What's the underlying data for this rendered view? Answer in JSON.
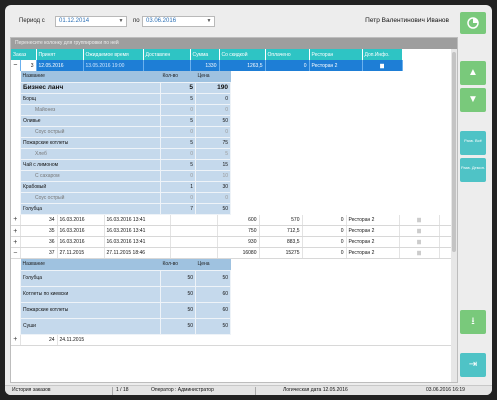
{
  "filter": {
    "period_label": "Период с",
    "from": "01.12.2014",
    "to_label": "по",
    "to": "03.06.2016"
  },
  "user": "Петр Валентинович Иванов",
  "group_hint": "Перенесите колонку для группировки по ней",
  "columns": [
    "Заказ",
    "Принят",
    "Ожидаемое время",
    "Доставлен",
    "Сумма",
    "Со скидкой",
    "Оплачено",
    "Ресторан",
    "Доп.Инфо."
  ],
  "selected": {
    "order": "3",
    "accepted": "12.05.2016",
    "expected": "13.05.2016 19:00",
    "delivered": "",
    "sum": "1330",
    "discount": "1263,5",
    "paid": "0",
    "rest": "Ресторан 2"
  },
  "detail_header": {
    "name": "Название",
    "qty": "Кол-во",
    "price": "Цена"
  },
  "detail1": [
    {
      "name": "Бизнес ланч",
      "qty": "5",
      "price": "190",
      "kind": "bold"
    },
    {
      "name": "Борщ",
      "qty": "5",
      "price": "0",
      "kind": "item"
    },
    {
      "name": "Майонез",
      "qty": "0",
      "price": "0",
      "kind": "sub"
    },
    {
      "name": "Оливье",
      "qty": "5",
      "price": "50",
      "kind": "item"
    },
    {
      "name": "Соус острый",
      "qty": "0",
      "price": "0",
      "kind": "sub"
    },
    {
      "name": "Пожарские котлеты",
      "qty": "5",
      "price": "75",
      "kind": "item"
    },
    {
      "name": "Хлеб",
      "qty": "0",
      "price": "5",
      "kind": "sub"
    },
    {
      "name": "Чай с лимоном",
      "qty": "5",
      "price": "15",
      "kind": "item"
    },
    {
      "name": "С сахаром",
      "qty": "0",
      "price": "10",
      "kind": "sub"
    },
    {
      "name": "Крабовый",
      "qty": "1",
      "price": "30",
      "kind": "item"
    },
    {
      "name": "Соус острый",
      "qty": "0",
      "price": "0",
      "kind": "sub"
    },
    {
      "name": "Голубца",
      "qty": "7",
      "price": "50",
      "kind": "item"
    }
  ],
  "orders": [
    {
      "exp": "+",
      "order": "34",
      "accepted": "16.03.2016",
      "expected": "16.03.2016 13:41",
      "sum": "600",
      "discount": "570",
      "paid": "0",
      "rest": "Ресторан 2"
    },
    {
      "exp": "+",
      "order": "35",
      "accepted": "16.03.2016",
      "expected": "16.03.2016 13:41",
      "sum": "750",
      "discount": "712,5",
      "paid": "0",
      "rest": "Ресторан 2"
    },
    {
      "exp": "+",
      "order": "36",
      "accepted": "16.03.2016",
      "expected": "16.03.2016 13:41",
      "sum": "930",
      "discount": "883,5",
      "paid": "0",
      "rest": "Ресторан 2"
    },
    {
      "exp": "−",
      "order": "37",
      "accepted": "27.11.2015",
      "expected": "27.11.2015 18:46",
      "sum": "16080",
      "discount": "15275",
      "paid": "0",
      "rest": "Ресторан 2"
    }
  ],
  "detail2": [
    {
      "name": "Голубца",
      "qty": "50",
      "price": "50"
    },
    {
      "name": "Котлеты по киевски",
      "qty": "50",
      "price": "60"
    },
    {
      "name": "Пожарские котлеты",
      "qty": "50",
      "price": "60"
    },
    {
      "name": "Суши",
      "qty": "50",
      "price": "50"
    }
  ],
  "last_row": {
    "exp": "+",
    "order": "24",
    "accepted": "24.11.2015"
  },
  "side": {
    "up": "▲",
    "down": "▼",
    "all_up": "Разв. Всё",
    "all_down": "Разв. Демон.",
    "download": "⭳",
    "exit": "⇥"
  },
  "status": {
    "history": "История заказов",
    "pages": "1 / 18",
    "operator": "Оператор : Администратор",
    "logical_date": "Логическая дата 12.05.2016",
    "datetime": "03.06.2016 16:19"
  }
}
